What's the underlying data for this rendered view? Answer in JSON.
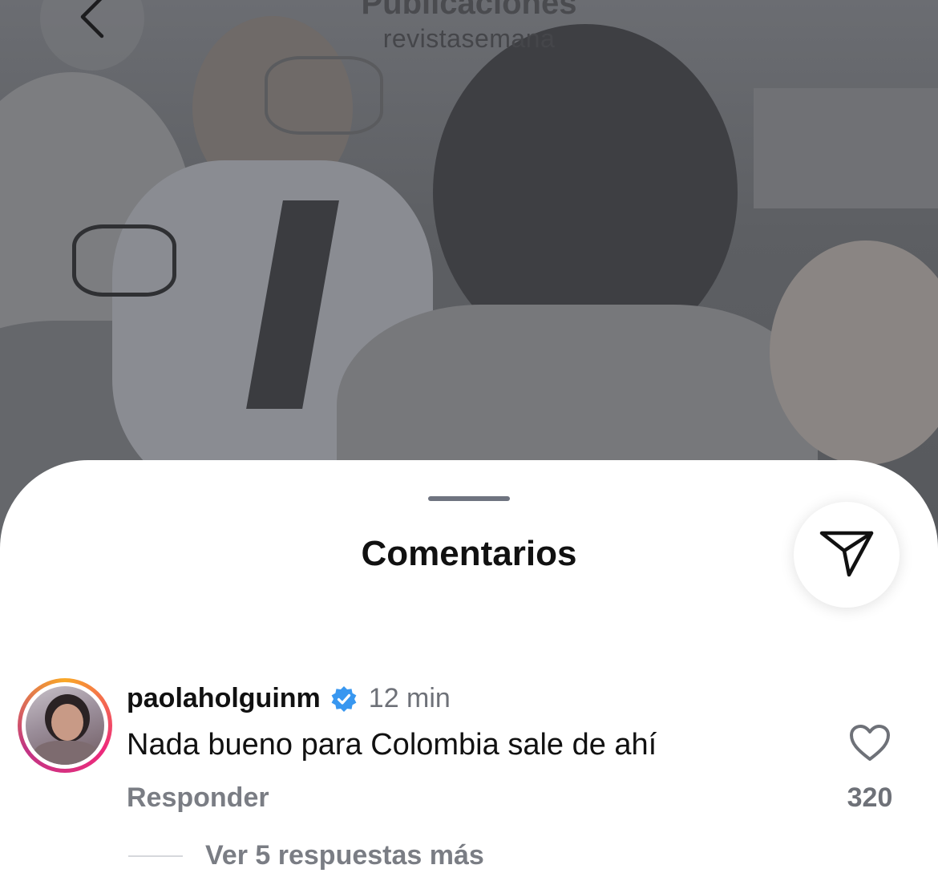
{
  "header": {
    "title": "Publicaciones",
    "subtitle": "revistasemana"
  },
  "sheet": {
    "title": "Comentarios"
  },
  "comment": {
    "username": "paolaholguinm",
    "time": "12 min",
    "text": "Nada bueno para Colombia sale de ahí",
    "reply_label": "Responder",
    "like_count": "320",
    "view_replies": "Ver 5 respuestas más"
  },
  "colors": {
    "verified": "#3897f0",
    "secondary_text": "#6e7178"
  },
  "icons": {
    "back": "chevron-left-icon",
    "share": "paper-plane-icon",
    "verified": "verified-badge-icon",
    "like": "heart-icon"
  }
}
